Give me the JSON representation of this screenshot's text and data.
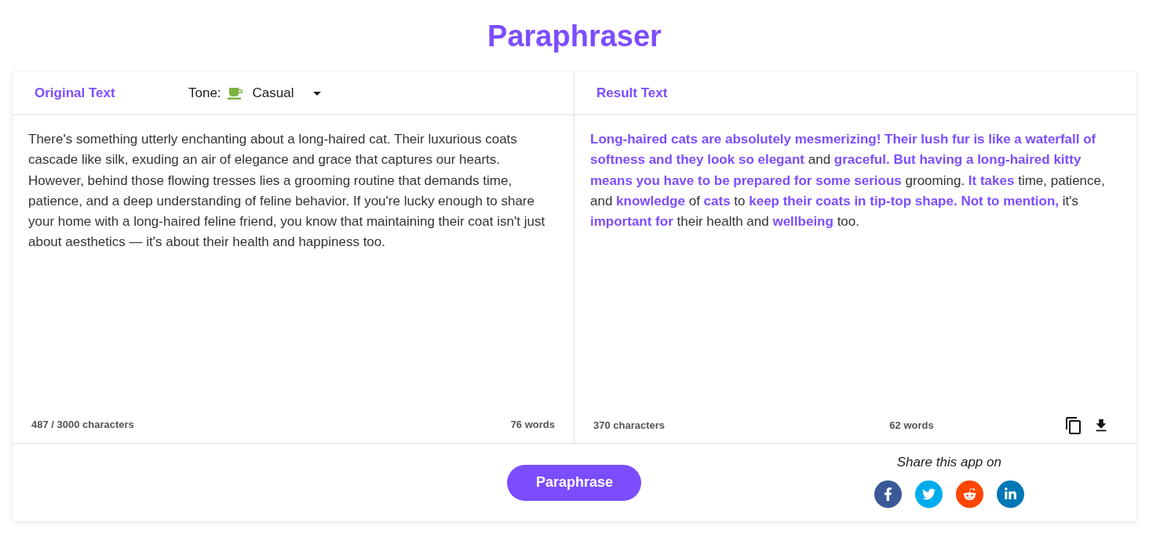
{
  "title": "Paraphraser",
  "original": {
    "heading": "Original Text",
    "tone": {
      "label": "Tone:",
      "value": "Casual"
    },
    "text": "There's something utterly enchanting about a long-haired cat. Their luxurious coats cascade like silk, exuding an air of elegance and grace that captures our hearts. However, behind those flowing tresses lies a grooming routine that demands time, patience, and a deep understanding of feline behavior. If you're lucky enough to share your home with a long-haired feline friend, you know that maintaining their coat isn't just about aesthetics — it's about their health and happiness too.",
    "characters": "487 / 3000 characters",
    "words": "76 words"
  },
  "result": {
    "heading": "Result Text",
    "text": "**Long-haired cats are absolutely mesmerizing! Their lush fur is like a waterfall of softness and they look so elegant** and **graceful. But having a long-haired kitty means you have to be prepared for some serious** grooming. **It takes** time, patience, and **knowledge** of **cats** to **keep their coats in tip-top shape. Not to mention,** it's **important for** their health and **wellbeing** too.",
    "characters": "370 characters",
    "words": "62 words"
  },
  "paraphrase_button": "Paraphrase",
  "share": {
    "label": "Share this app on",
    "networks": [
      {
        "kind": "facebook",
        "color": "#3b5998"
      },
      {
        "kind": "twitter",
        "color": "#00acee"
      },
      {
        "kind": "reddit",
        "color": "#ff4500"
      },
      {
        "kind": "linkedin",
        "color": "#0077b5"
      }
    ]
  }
}
